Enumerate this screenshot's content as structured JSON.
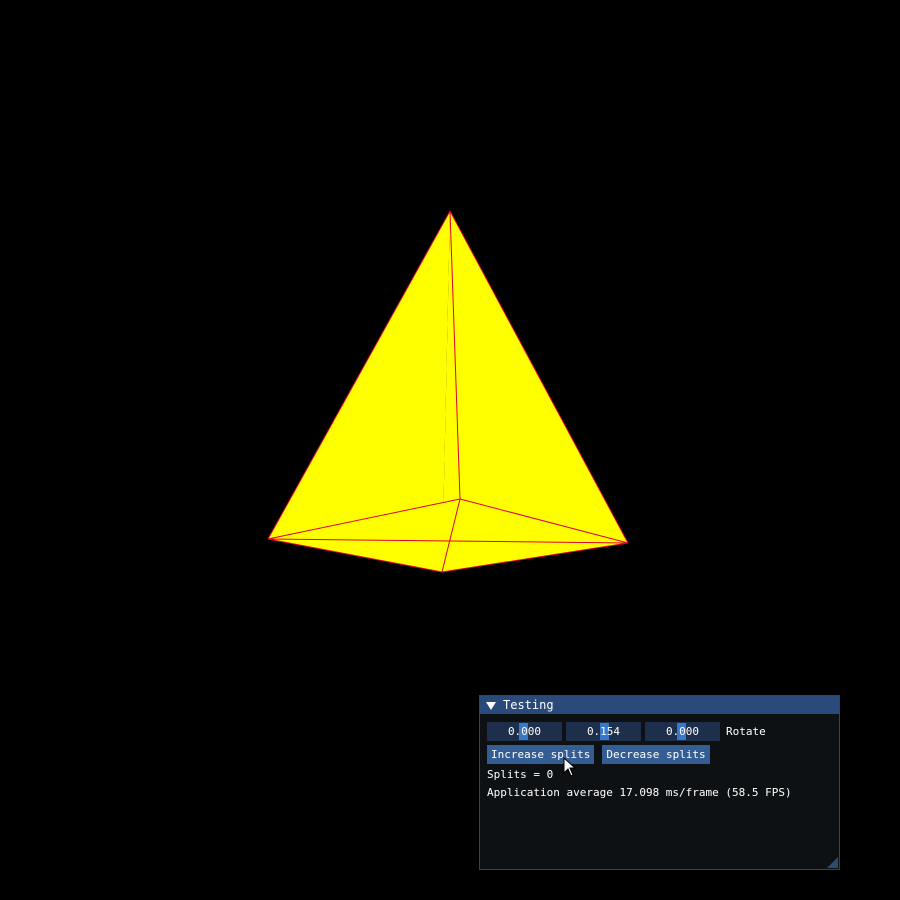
{
  "scene": {
    "background": "#000000",
    "face_color": "#ffff00",
    "edge_color": "#e0003a"
  },
  "panel": {
    "title": "Testing",
    "collapse_icon": "triangle-down-icon",
    "rotate": {
      "values": [
        "0.000",
        "0.154",
        "0.000"
      ],
      "label": "Rotate"
    },
    "buttons": {
      "increase_label": "Increase splits",
      "decrease_label": "Decrease splits"
    },
    "splits_text": "Splits = 0",
    "fps_text": "Application average 17.098 ms/frame (58.5 FPS)",
    "title_color": "#294a7a",
    "button_color": "#345e93",
    "frame_color": "#1d2f4a"
  }
}
